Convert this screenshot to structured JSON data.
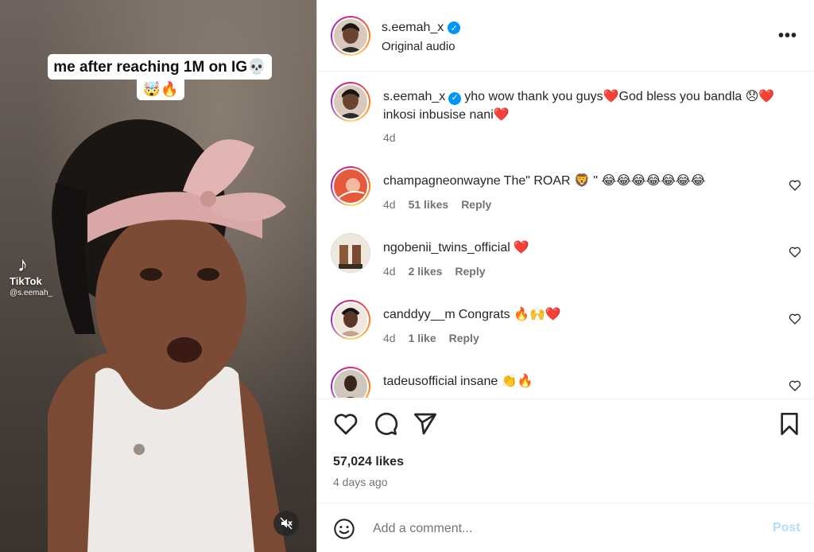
{
  "video": {
    "caption_line1": "me after reaching 1M on IG💀",
    "caption_line2": "🤯🔥",
    "watermark_brand": "TikTok",
    "watermark_user": "@s.eemah_",
    "mute_icon": "speaker-muted-icon"
  },
  "header": {
    "username": "s.eemah_x",
    "verified": true,
    "audio": "Original audio",
    "more_label": "•••"
  },
  "caption_comment": {
    "username": "s.eemah_x",
    "text": "yho wow thank you guys❤️God bless you bandla 😞❤️inkosi inbusise nani❤️",
    "age": "4d"
  },
  "comments": [
    {
      "username": "champagneonwayne",
      "text": "The\" ROAR 🦁 \" 😂😂😂😂😂😂😂",
      "age": "4d",
      "likes": "51 likes",
      "reply": "Reply"
    },
    {
      "username": "ngobenii_twins_official",
      "text": "❤️",
      "age": "4d",
      "likes": "2 likes",
      "reply": "Reply"
    },
    {
      "username": "canddyy__m",
      "text": "Congrats 🔥🙌❤️",
      "age": "4d",
      "likes": "1 like",
      "reply": "Reply"
    },
    {
      "username": "tadeusofficial",
      "text": "insane 👏🔥",
      "age": "",
      "likes": "",
      "reply": ""
    }
  ],
  "actions": {
    "icons": [
      "heart-icon",
      "comment-icon",
      "share-icon",
      "bookmark-icon"
    ],
    "likes_total": "57,024 likes",
    "posted": "4 days ago"
  },
  "add_comment": {
    "placeholder": "Add a comment...",
    "post_label": "Post"
  },
  "colors": {
    "accent": "#0095f6",
    "post_disabled": "#b2dffc",
    "secondary_text": "#737373",
    "like_red": "#ed4956"
  }
}
